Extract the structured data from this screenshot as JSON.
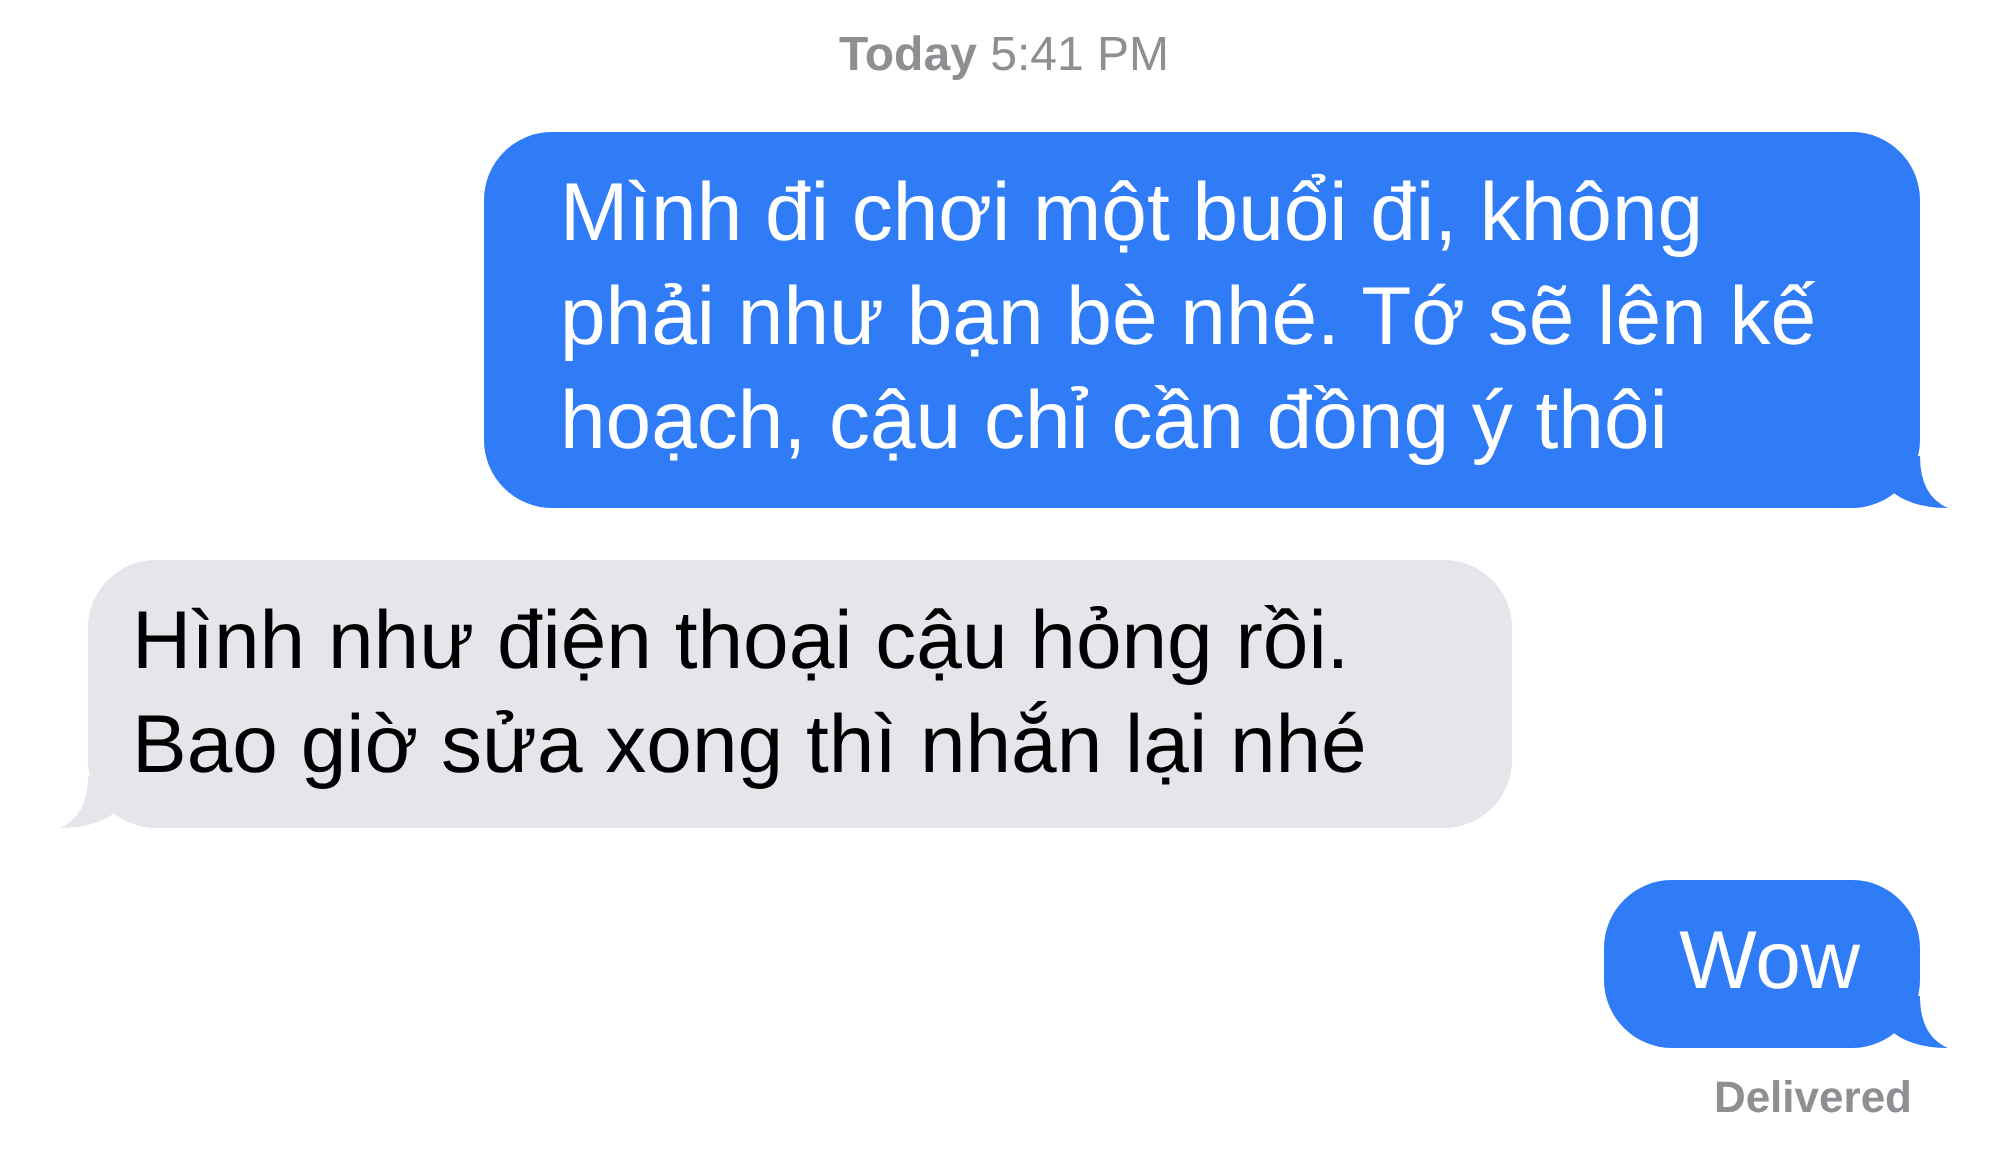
{
  "timestamp": "**Today** 5:41 PM",
  "messages": [
    {
      "kind": "sent",
      "text": "Mình đi chơi một buổi đi, không phải như bạn bè nhé. Tớ sẽ lên kế hoạch, cậu chỉ cần đồng ý thôi"
    },
    {
      "kind": "received",
      "text": "Hình như điện thoại cậu hỏng rồi. Bao giờ sửa xong thì nhắn lại nhé"
    },
    {
      "kind": "sent",
      "text": "Wow"
    }
  ],
  "status": "Delivered"
}
